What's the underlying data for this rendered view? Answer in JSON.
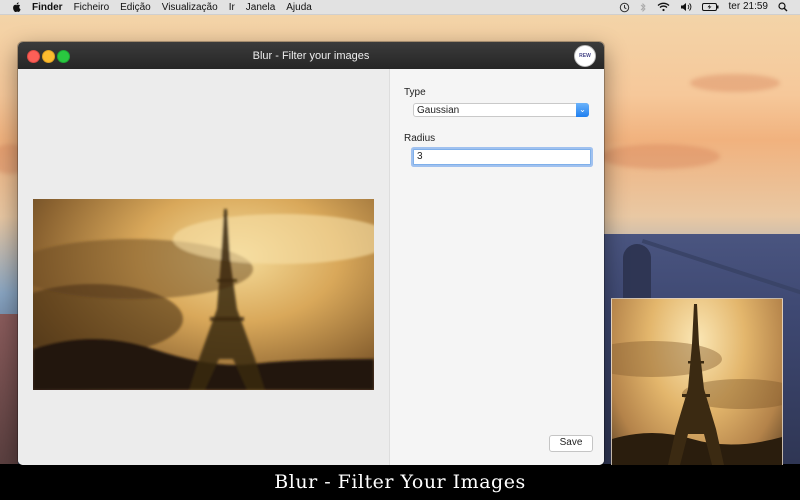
{
  "menubar": {
    "items": [
      "Finder",
      "Ficheiro",
      "Edição",
      "Visualização",
      "Ir",
      "Janela",
      "Ajuda"
    ],
    "clock": "ter 21:59",
    "status_icons": [
      "apple-icon",
      "time-machine-icon",
      "bluetooth-icon",
      "wifi-icon",
      "volume-icon",
      "battery-icon",
      "spotlight-icon"
    ]
  },
  "window": {
    "title": "Blur - Filter your images",
    "badge": "REW",
    "sidebar": {
      "type_label": "Type",
      "type_value": "Gaussian",
      "radius_label": "Radius",
      "radius_value": "3",
      "save_label": "Save"
    }
  },
  "caption": "Blur - Filter Your Images",
  "colors": {
    "accent": "#1f7ff0",
    "titlebar": "#2e2e2e",
    "caption_bg": "#000000"
  }
}
